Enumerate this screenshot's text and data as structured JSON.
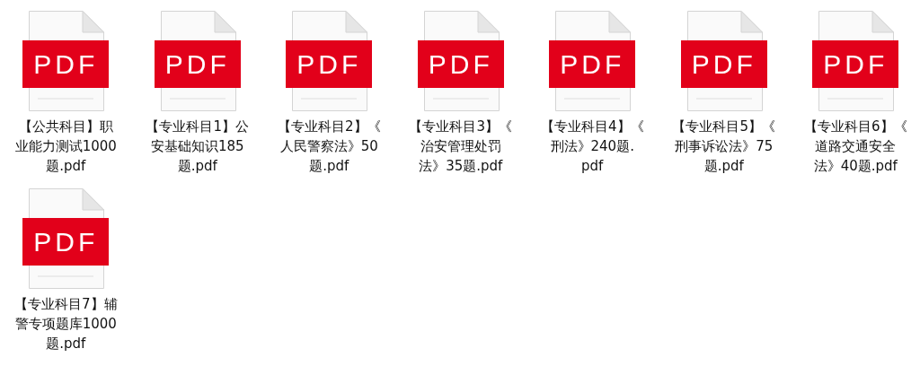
{
  "files": [
    {
      "badge": "PDF",
      "label_lines": [
        "【公共科目】职",
        "业能力测试1000",
        "题.pdf"
      ]
    },
    {
      "badge": "PDF",
      "label_lines": [
        "【专业科目1】公",
        "安基础知识185",
        "题.pdf"
      ]
    },
    {
      "badge": "PDF",
      "label_lines": [
        "【专业科目2】《",
        "人民警察法》50",
        "题.pdf"
      ]
    },
    {
      "badge": "PDF",
      "label_lines": [
        "【专业科目3】《",
        "治安管理处罚",
        "法》35题.pdf"
      ]
    },
    {
      "badge": "PDF",
      "label_lines": [
        "【专业科目4】《",
        "刑法》240题.",
        "pdf"
      ]
    },
    {
      "badge": "PDF",
      "label_lines": [
        "【专业科目5】《",
        "刑事诉讼法》75",
        "题.pdf"
      ]
    },
    {
      "badge": "PDF",
      "label_lines": [
        "【专业科目6】《",
        "道路交通安全",
        "法》40题.pdf"
      ]
    },
    {
      "badge": "PDF",
      "label_lines": [
        "【专业科目7】辅",
        "警专项题库1000",
        "题.pdf"
      ]
    }
  ]
}
